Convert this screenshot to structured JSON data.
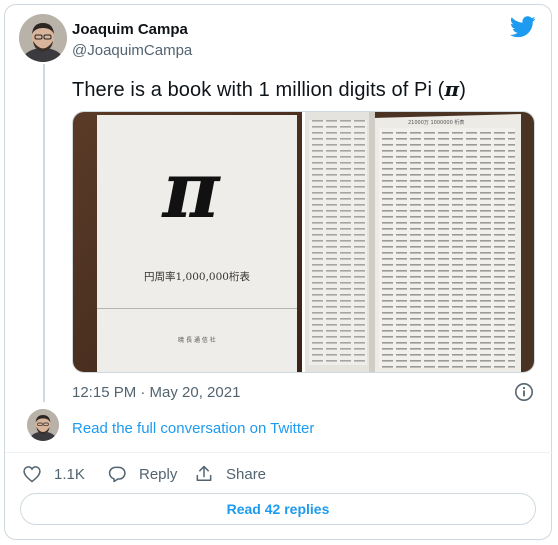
{
  "author": {
    "name": "Joaquim Campa",
    "handle": "@JoaquimCampa"
  },
  "tweet": {
    "text_before": "There is a book with 1 million digits of Pi (",
    "pi_symbol": "π",
    "text_after": ")",
    "timestamp": "12:15 PM · May 20, 2021"
  },
  "media": {
    "left_photo": {
      "cover_symbol": "π",
      "cover_title": "円周率1,000,000桁表",
      "publisher": "暁 長 通 信 社"
    },
    "right_photo": {
      "page_header": "21000万 1000000 桁表"
    }
  },
  "read_conversation": "Read the full conversation on Twitter",
  "actions": {
    "like_count": "1.1K",
    "reply_label": "Reply",
    "share_label": "Share"
  },
  "replies_button": "Read 42 replies",
  "colors": {
    "accent": "#1d9bf0",
    "muted": "#536471",
    "text": "#0f1419",
    "border": "#cfd9de"
  }
}
